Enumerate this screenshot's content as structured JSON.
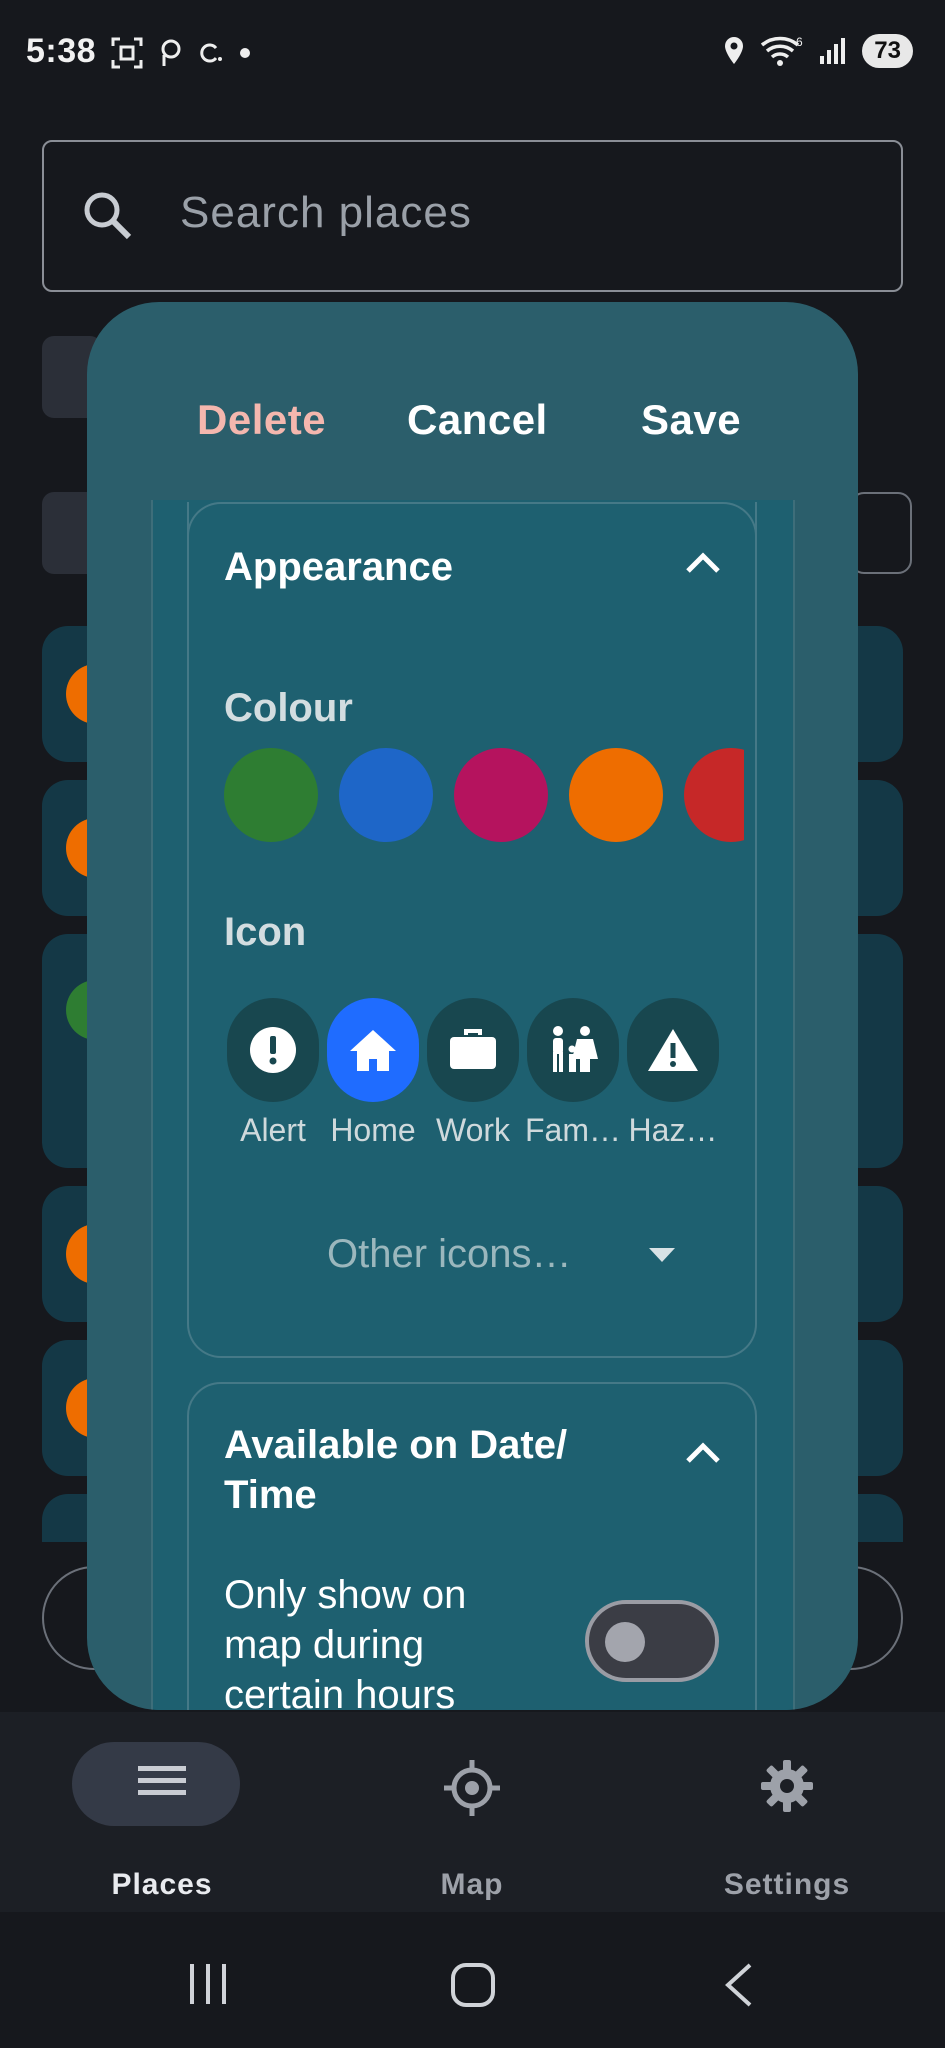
{
  "status_bar": {
    "time": "5:38",
    "battery": "73",
    "network_badge": "6"
  },
  "search": {
    "placeholder": "Search places"
  },
  "dialog": {
    "actions": {
      "delete": "Delete",
      "cancel": "Cancel",
      "save": "Save"
    },
    "appearance": {
      "title": "Appearance",
      "colour_label": "Colour",
      "colours": [
        "#2e7d32",
        "#1e66c8",
        "#b5135e",
        "#ee6d00",
        "#c62828"
      ],
      "icon_label": "Icon",
      "icons": [
        {
          "name": "alert-icon",
          "label": "Alert",
          "selected": false
        },
        {
          "name": "home-icon",
          "label": "Home",
          "selected": true
        },
        {
          "name": "work-icon",
          "label": "Work",
          "selected": false
        },
        {
          "name": "family-icon",
          "label": "Fam…",
          "selected": false
        },
        {
          "name": "hazard-icon",
          "label": "Haz…",
          "selected": false
        }
      ],
      "other_icons": "Other icons…"
    },
    "availability": {
      "title": "Available on Date/\nTime",
      "toggle_label": "Only show on map during certain hours",
      "toggle_on": false
    }
  },
  "bottom_nav": {
    "items": [
      {
        "label": "Places",
        "icon": "list-icon",
        "active": true
      },
      {
        "label": "Map",
        "icon": "target-icon",
        "active": false
      },
      {
        "label": "Settings",
        "icon": "gear-icon",
        "active": false
      }
    ]
  },
  "colors": {
    "dialog_bg": "#2b5e6b",
    "accent": "#1f6cff",
    "delete": "#f4b7ae"
  }
}
